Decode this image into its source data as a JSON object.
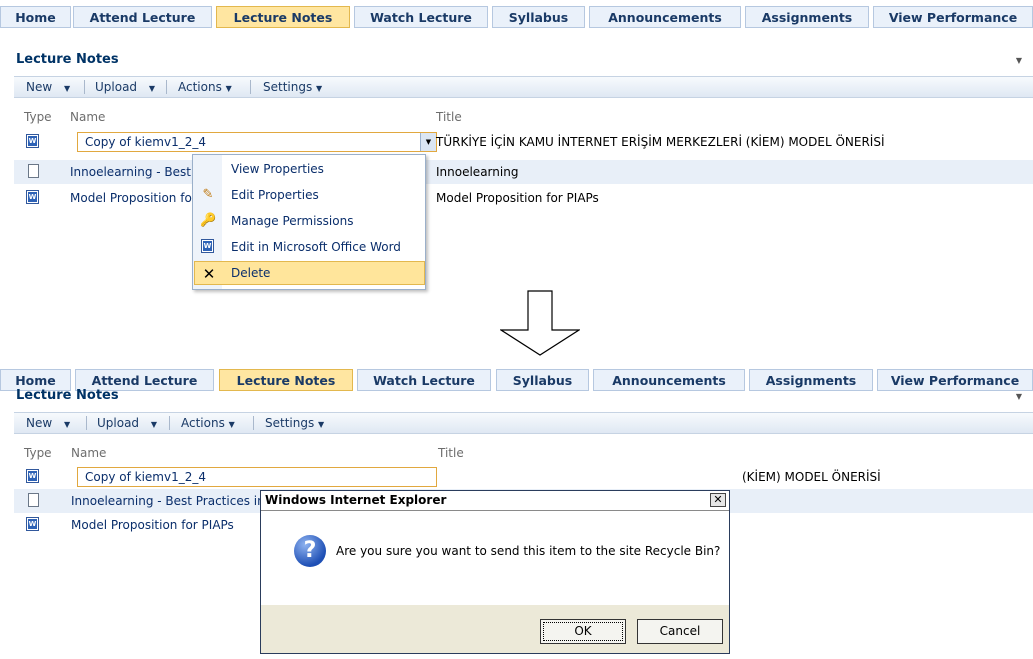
{
  "tabs": [
    "Home",
    "Attend Lecture",
    "Lecture Notes",
    "Watch Lecture",
    "Syllabus",
    "Announcements",
    "Assignments",
    "View Performance"
  ],
  "active_tab": "Lecture Notes",
  "page_title": "Lecture Notes",
  "toolbar": {
    "new": "New",
    "upload": "Upload",
    "actions": "Actions",
    "settings": "Settings"
  },
  "columns": {
    "type": "Type",
    "name": "Name",
    "title": "Title"
  },
  "before": {
    "rows": [
      {
        "name": "Copy of kiemv1_2_4",
        "title": "TÜRKİYE İÇİN KAMU İNTERNET ERİŞİM MERKEZLERİ (KİEM) MODEL ÖNERİSİ"
      },
      {
        "name": "Innoelearning - Best I",
        "title": "Innoelearning"
      },
      {
        "name": "Model Proposition for",
        "title": "Model Proposition for PIAPs"
      }
    ],
    "menu": [
      "View Properties",
      "Edit Properties",
      "Manage Permissions",
      "Edit in Microsoft Office Word",
      "Delete"
    ]
  },
  "after": {
    "rows": [
      {
        "name": "Copy of kiemv1_2_4",
        "title": "(KİEM) MODEL ÖNERİSİ"
      },
      {
        "name": "Innoelearning - Best Practices in",
        "title": ""
      },
      {
        "name": "Model Proposition for PIAPs",
        "title": ""
      }
    ],
    "dialog": {
      "title": "Windows Internet Explorer",
      "message": "Are you sure you want to send this item to the site Recycle Bin?",
      "ok": "OK",
      "cancel": "Cancel"
    }
  }
}
